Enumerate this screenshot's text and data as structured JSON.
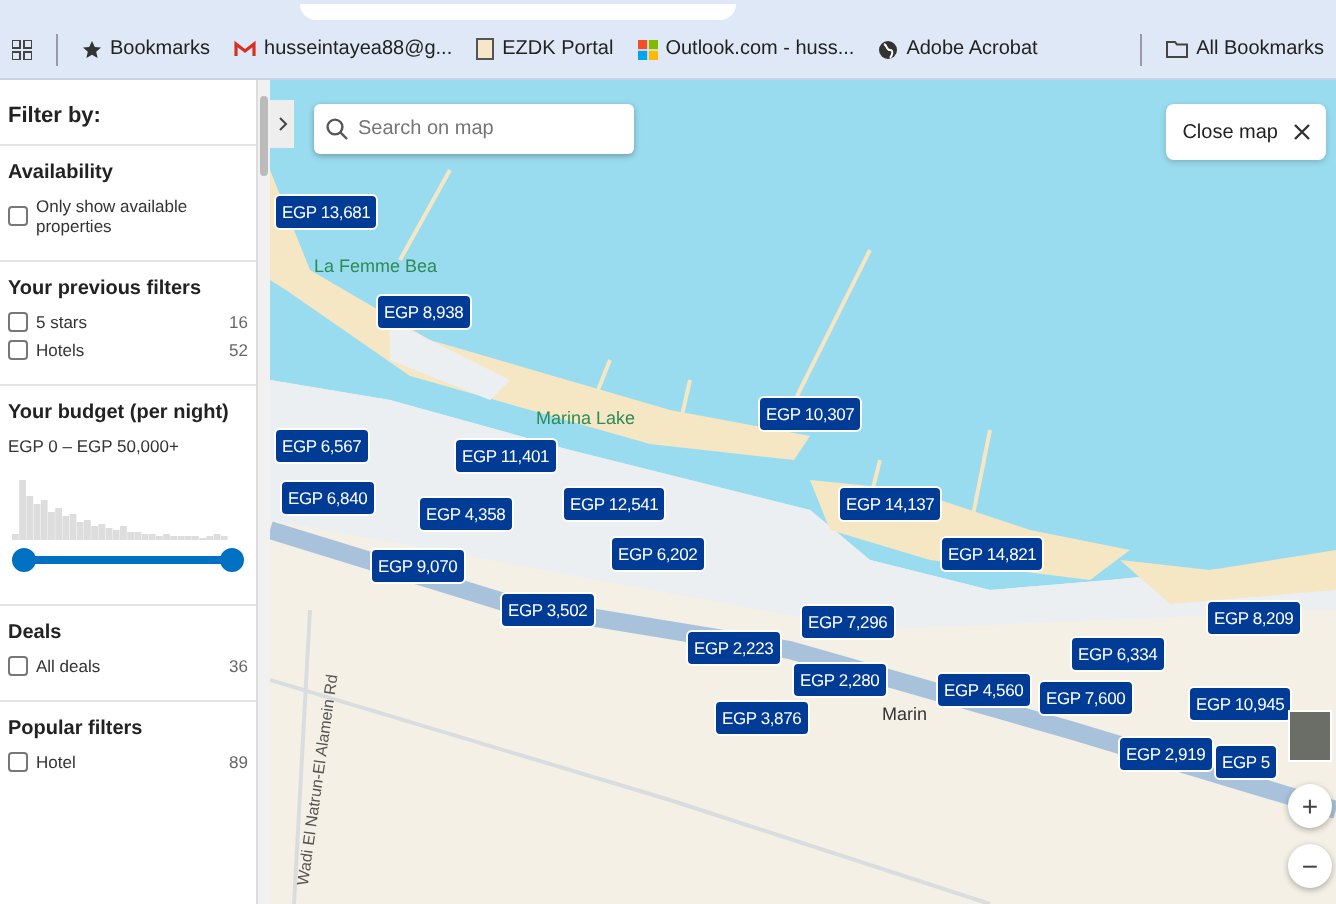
{
  "bookmarks_bar": {
    "items": [
      {
        "kind": "bookmarks",
        "label": "Bookmarks"
      },
      {
        "kind": "gmail",
        "label": "husseintayea88@g..."
      },
      {
        "kind": "page",
        "label": "EZDK Portal"
      },
      {
        "kind": "outlook",
        "label": "Outlook.com - huss..."
      },
      {
        "kind": "globe",
        "label": "Adobe Acrobat"
      }
    ],
    "all_bookmarks": "All Bookmarks"
  },
  "sidebar": {
    "title": "Filter by:",
    "sections": [
      {
        "heading": "Availability",
        "options": [
          {
            "label": "Only show available properties",
            "checked": false
          }
        ]
      },
      {
        "heading": "Your previous filters",
        "options": [
          {
            "label": "5 stars",
            "count": "16",
            "checked": false
          },
          {
            "label": "Hotels",
            "count": "52",
            "checked": false
          }
        ]
      },
      {
        "heading": "Your budget (per night)",
        "range_text": "EGP 0 – EGP 50,000+",
        "handles": [
          {
            "level": 0
          },
          {
            "level": 1
          }
        ]
      },
      {
        "heading": "Deals",
        "options": [
          {
            "label": "All deals",
            "count": "36",
            "checked": false
          }
        ]
      },
      {
        "heading": "Popular filters",
        "options": [
          {
            "label": "Hotel",
            "count": "89",
            "checked": false
          }
        ]
      }
    ]
  },
  "map": {
    "search": {
      "placeholder": "Search on map"
    },
    "close_button": "Close map",
    "labels": [
      "La Femme Bea",
      "Marina Lake",
      "Marin",
      "Wadi El Natrun-El Alamein Rd"
    ],
    "price_pins": [
      "EGP 13,681",
      "EGP 8,938",
      "EGP 10,307",
      "EGP 6,567",
      "EGP 11,401",
      "EGP 6,840",
      "EGP 4,358",
      "EGP 12,541",
      "EGP 6,202",
      "EGP 9,070",
      "EGP 3,502",
      "EGP 14,137",
      "EGP 14,821",
      "EGP 7,296",
      "EGP 8,209",
      "EGP 2,223",
      "EGP 6,334",
      "EGP 2,280",
      "EGP 4,560",
      "EGP 7,600",
      "EGP 3,876",
      "EGP 10,945",
      "EGP 2,919",
      "EGP 5"
    ],
    "zoom_in": "+",
    "zoom_out": "−"
  }
}
